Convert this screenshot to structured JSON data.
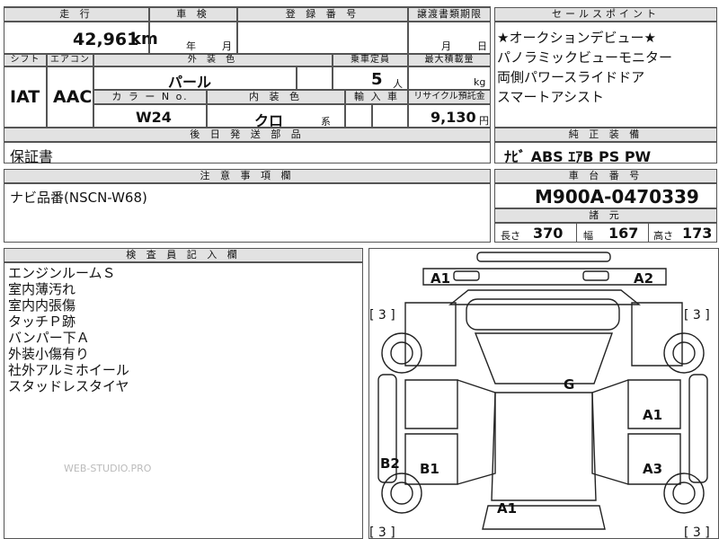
{
  "header": {
    "mileage_label": "走 行",
    "inspection_label": "車 検",
    "reg_label": "登 録 番 号",
    "transfer_label": "譲渡書類期限",
    "sales_label": "セールスポイント"
  },
  "values": {
    "mileage": "42,961",
    "mileage_unit": "km",
    "year_unit": "年",
    "month_unit": "月",
    "month2": "月",
    "day": "日"
  },
  "labels": {
    "shift": "シフト",
    "aircon": "エアコン",
    "ext_color": "外 装 色",
    "capacity": "乗車定員",
    "max_load": "最大積載量",
    "color_no": "カ ラ ー N o.",
    "int_color": "内 装 色",
    "import": "輸 入 車",
    "recycle": "リサイクル預託金",
    "back_parts": "後 日 発 送 部 品",
    "standard_equip": "純 正 装 備",
    "notes": "注 意 事 項 欄",
    "chassis": "車 台 番 号",
    "specs": "諸 元",
    "inspector": "検 査 員 記 入 欄"
  },
  "vehicle": {
    "shift": "IAT",
    "aircon": "AAC",
    "ext_color": "パール",
    "capacity": "5",
    "capacity_unit": "人",
    "load_unit": "kg",
    "color_no": "W24",
    "int_color": "クロ",
    "int_suffix": "系",
    "recycle": "9,130",
    "recycle_unit": "円",
    "back_parts": "保証書",
    "equipment": "ﾅﾋﾞ ABS ｴｱB PS PW",
    "notes": "ナビ品番(NSCN-W68)",
    "chassis": "M900A-0470339",
    "length_label": "長さ",
    "length": "370",
    "width_label": "幅",
    "width": "167",
    "height_label": "高さ",
    "height": "173"
  },
  "sales_points": [
    "★オークションデビュー★",
    "パノラミックビューモニター",
    "両側パワースライドドア",
    "スマートアシスト"
  ],
  "inspector_notes": [
    "エンジンルームＳ",
    "室内薄汚れ",
    "室内内張傷",
    "タッチＰ跡",
    "バンパー下Ａ",
    "外装小傷有り",
    "社外アルミホイール",
    "スタッドレスタイヤ"
  ],
  "watermark": "WEB-STUDIO.PRO",
  "diagram": {
    "a1_front_left": "A1",
    "a2_front_right": "A2",
    "tire_fl": "[ 3 ]",
    "tire_fr": "[ 3 ]",
    "tire_rl": "[ 3 ]",
    "tire_rr": "[ 3 ]",
    "g_roof": "G",
    "a1_right_door": "A1",
    "b2_left": "B2",
    "b1_left_door": "B1",
    "a3_right": "A3",
    "a1_rear": "A1"
  }
}
